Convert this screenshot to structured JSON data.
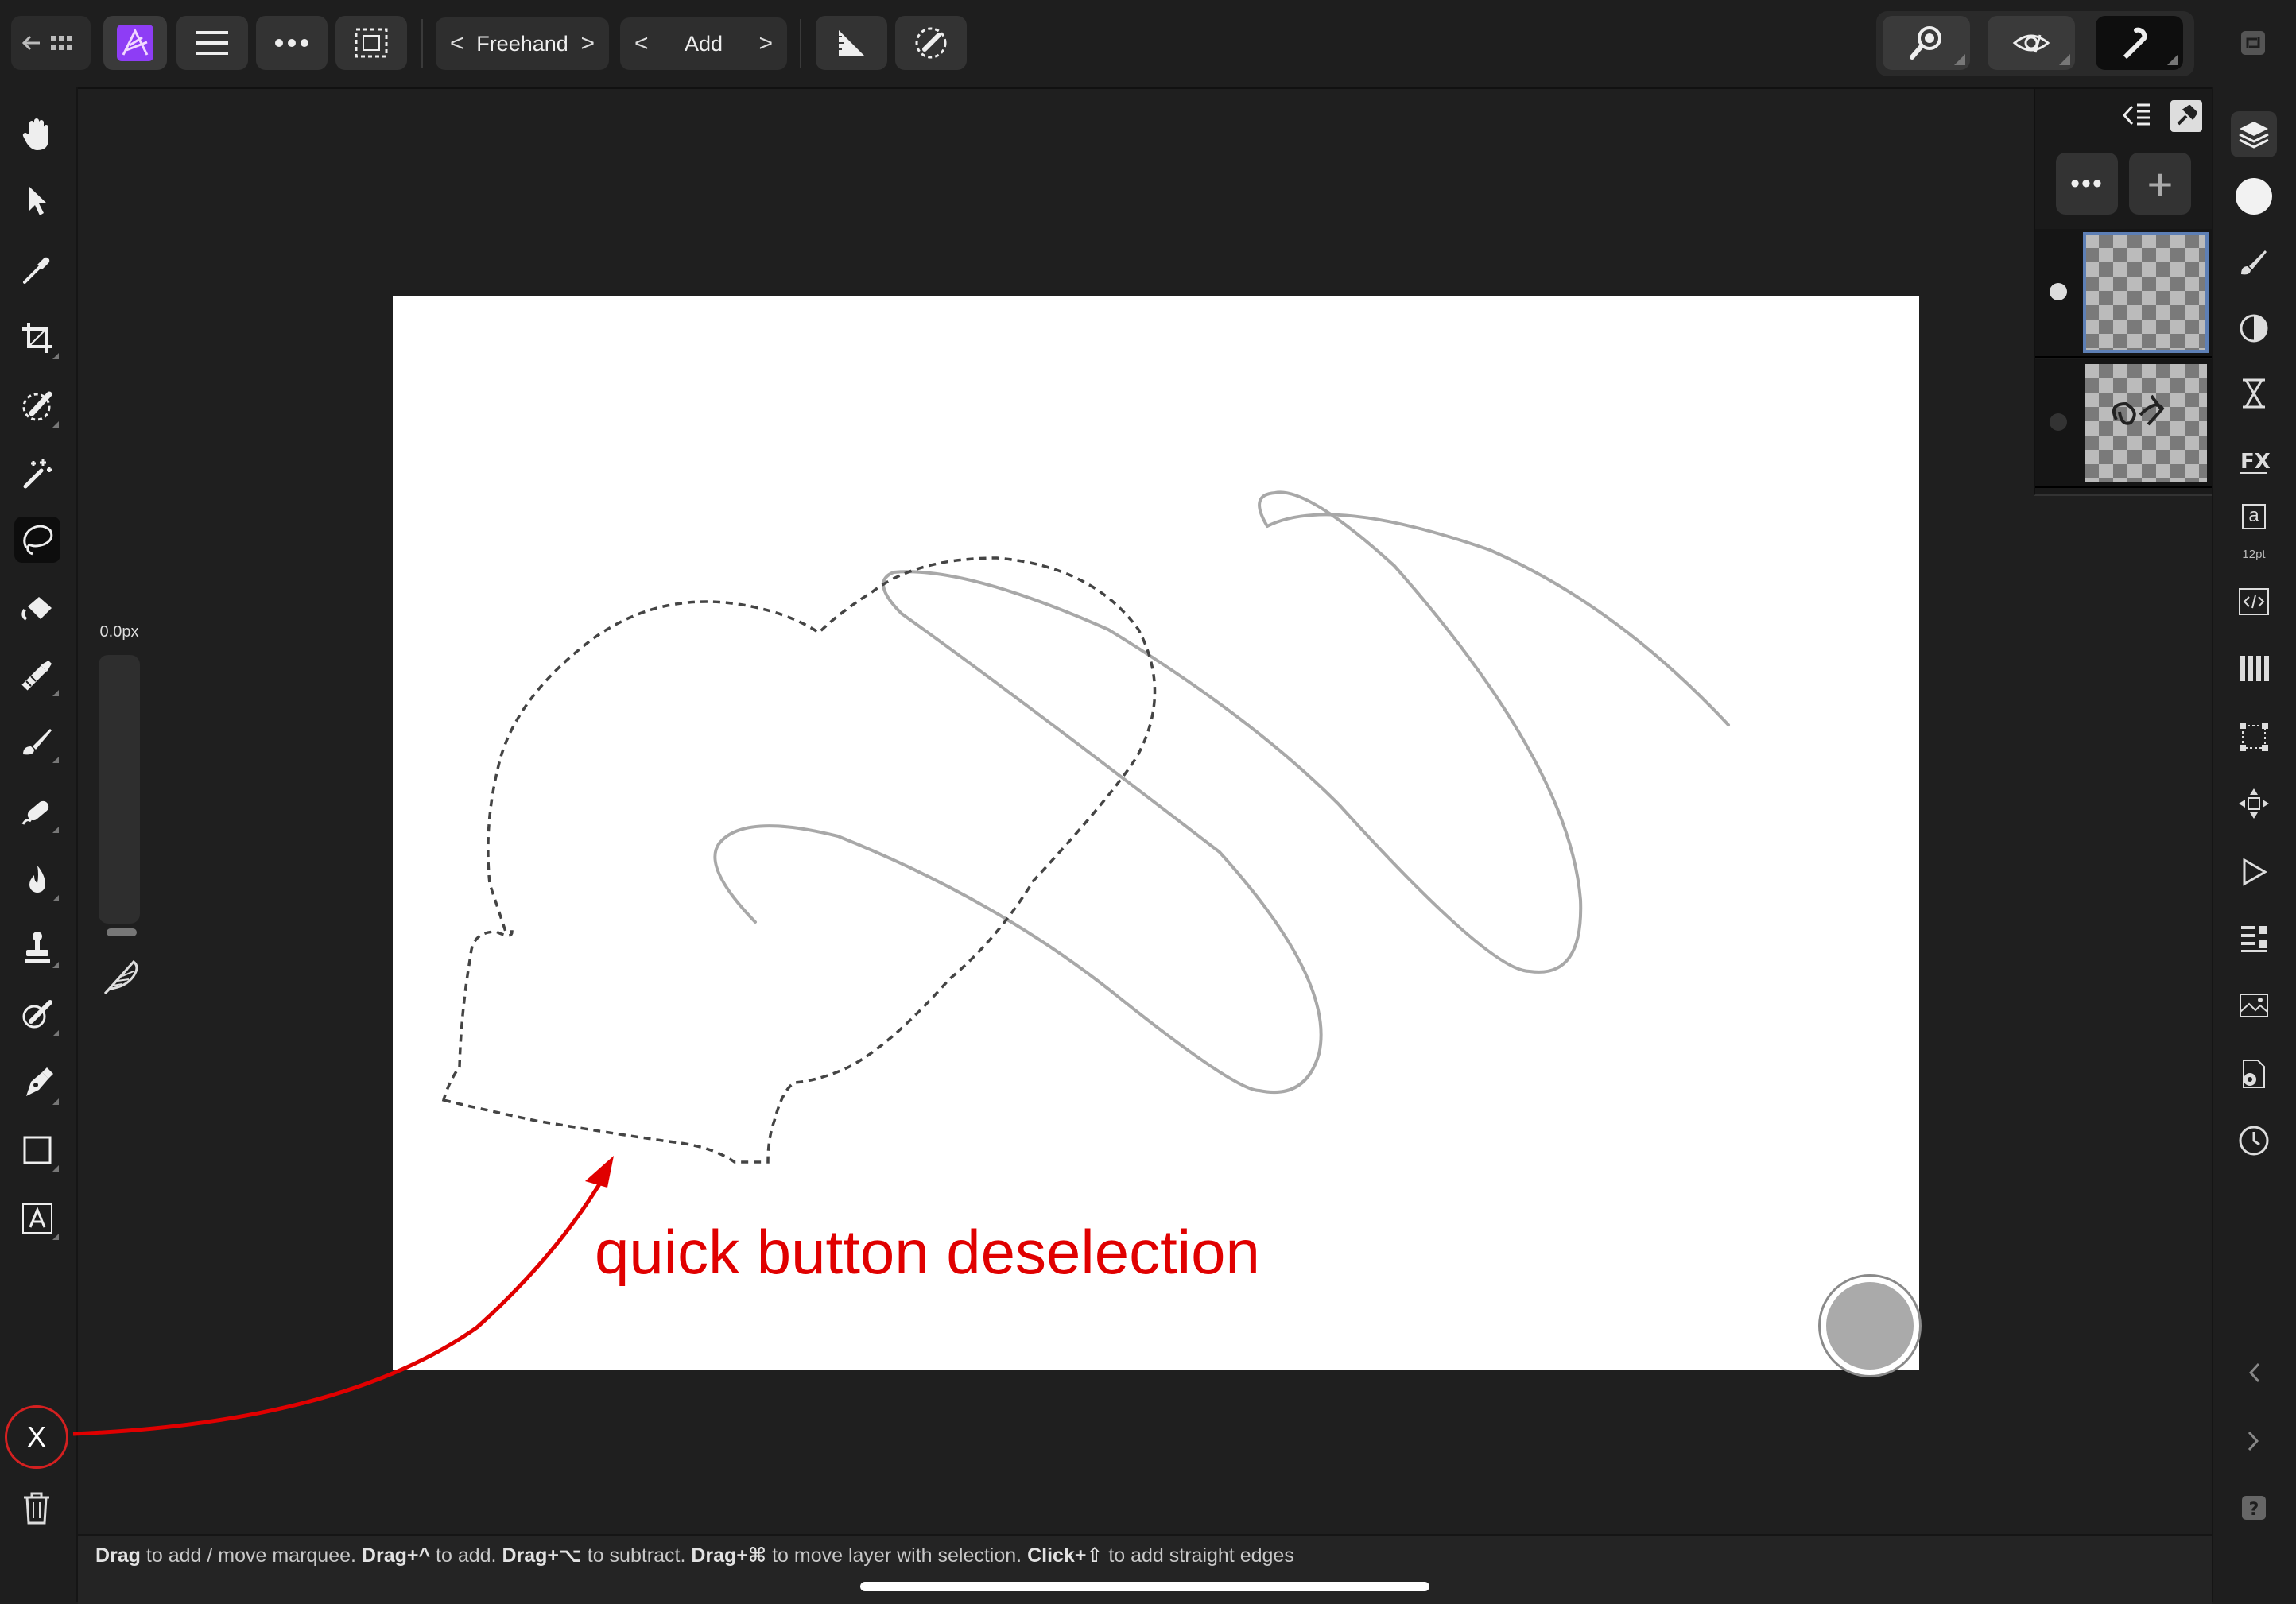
{
  "toolbar": {
    "persona_mode": "Freehand",
    "selection_mode": "Add",
    "prev_glyph": "<",
    "next_glyph": ">"
  },
  "icons": {
    "top": [
      "back-grid-icon",
      "affinity-photo-logo",
      "hamburger-menu-icon",
      "more-icon",
      "selection-marquee-icon",
      "ruler-icon",
      "brush-selection-icon",
      "zoom-icon",
      "view-eye-icon",
      "snapping-magnet-icon",
      "window-icon"
    ],
    "left_tools": [
      "hand-icon",
      "move-pointer-icon",
      "color-picker-icon",
      "crop-icon",
      "selection-brush-icon",
      "magic-wand-icon",
      "freehand-selection-icon",
      "flood-fill-icon",
      "smudge-icon",
      "paint-brush-icon",
      "healing-icon",
      "burn-icon",
      "clone-stamp-icon",
      "retouch-brush-icon",
      "pen-icon",
      "rectangle-icon",
      "artistic-text-icon"
    ],
    "right_studio": [
      "layers-icon",
      "color-icon",
      "brush-icon",
      "adjustments-icon",
      "history-hourglass-icon",
      "fx-icon",
      "character-icon",
      "source-icon",
      "channels-icon",
      "transform-icon",
      "navigator-icon",
      "macro-icon",
      "stock-icon",
      "photos-icon",
      "settings-icon",
      "history-icon",
      "collapse-left-icon",
      "expand-right-icon",
      "help-icon"
    ]
  },
  "layers_panel": {
    "more_glyph": "•••",
    "add_glyph": "+"
  },
  "text_studio": {
    "size_label": "12pt",
    "glyph": "a"
  },
  "brush_width": {
    "label": "0.0px"
  },
  "deselect_button": {
    "label": "X"
  },
  "annotation": {
    "text": "quick button deselection",
    "color": "#e00000"
  },
  "status_bar": {
    "d1": "Drag",
    "t1": " to add / move marquee. ",
    "d2": "Drag+^",
    "t2": " to add. ",
    "d3": "Drag+⌥",
    "t3": " to subtract. ",
    "d4": "Drag+⌘",
    "t4": " to move layer with selection. ",
    "d5": "Click+⇧",
    "t5": " to add straight edges"
  },
  "colors": {
    "background": "#1f1f1f",
    "canvas": "#ffffff",
    "accent_purple": "#9b4dff",
    "selected_layer_outline": "#5d7fb5"
  }
}
